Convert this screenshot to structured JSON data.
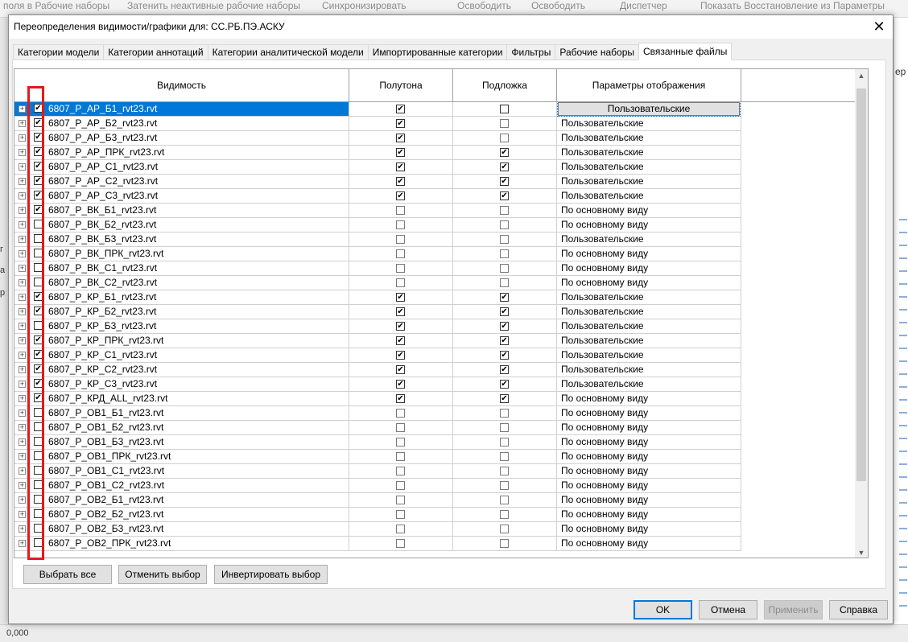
{
  "background": {
    "ribbon": [
      {
        "text": "поля в  Рабочие наборы"
      },
      {
        "text": "Затенить неактивные рабочие наборы"
      },
      {
        "text": "Синхронизировать"
      },
      {
        "text": "Освободить"
      },
      {
        "text": "Освободить"
      },
      {
        "text": "Диспетчер"
      },
      {
        "text": "Показать  Восстановление из   Параметры"
      }
    ],
    "right_label": "ер",
    "left_labels": [
      "г",
      "а",
      "р"
    ],
    "status_value": "0,000"
  },
  "dialog": {
    "title": "Переопределения видимости/графики для: СС.РБ.ПЭ.АСКУ",
    "close_label": "✕",
    "tabs": [
      {
        "label": "Категории модели",
        "active": false
      },
      {
        "label": "Категории аннотаций",
        "active": false
      },
      {
        "label": "Категории аналитической модели",
        "active": false
      },
      {
        "label": "Импортированные категории",
        "active": false
      },
      {
        "label": "Фильтры",
        "active": false
      },
      {
        "label": "Рабочие наборы",
        "active": false
      },
      {
        "label": "Связанные файлы",
        "active": true
      }
    ],
    "columns": [
      "Видимость",
      "Полутона",
      "Подложка",
      "Параметры отображения"
    ],
    "rows": [
      {
        "name": "6807_Р_АР_Б1_rvt23.rvt",
        "visible": true,
        "halftone": true,
        "underlay": false,
        "display": "Пользовательские",
        "selected": true
      },
      {
        "name": "6807_Р_АР_Б2_rvt23.rvt",
        "visible": true,
        "halftone": true,
        "underlay": false,
        "display": "Пользовательские"
      },
      {
        "name": "6807_Р_АР_Б3_rvt23.rvt",
        "visible": true,
        "halftone": true,
        "underlay": false,
        "display": "Пользовательские"
      },
      {
        "name": "6807_Р_АР_ПРК_rvt23.rvt",
        "visible": true,
        "halftone": true,
        "underlay": true,
        "display": "Пользовательские"
      },
      {
        "name": "6807_Р_АР_С1_rvt23.rvt",
        "visible": true,
        "halftone": true,
        "underlay": true,
        "display": "Пользовательские"
      },
      {
        "name": "6807_Р_АР_С2_rvt23.rvt",
        "visible": true,
        "halftone": true,
        "underlay": true,
        "display": "Пользовательские"
      },
      {
        "name": "6807_Р_АР_С3_rvt23.rvt",
        "visible": true,
        "halftone": true,
        "underlay": true,
        "display": "Пользовательские"
      },
      {
        "name": "6807_Р_ВК_Б1_rvt23.rvt",
        "visible": true,
        "halftone": false,
        "underlay": false,
        "display": "По основному виду"
      },
      {
        "name": "6807_Р_ВК_Б2_rvt23.rvt",
        "visible": false,
        "halftone": false,
        "underlay": false,
        "display": "По основному виду"
      },
      {
        "name": "6807_Р_ВК_Б3_rvt23.rvt",
        "visible": false,
        "halftone": false,
        "underlay": false,
        "display": "Пользовательские"
      },
      {
        "name": "6807_Р_ВК_ПРК_rvt23.rvt",
        "visible": false,
        "halftone": false,
        "underlay": false,
        "display": "По основному виду"
      },
      {
        "name": "6807_Р_ВК_С1_rvt23.rvt",
        "visible": false,
        "halftone": false,
        "underlay": false,
        "display": "По основному виду"
      },
      {
        "name": "6807_Р_ВК_С2_rvt23.rvt",
        "visible": false,
        "halftone": false,
        "underlay": false,
        "display": "По основному виду"
      },
      {
        "name": "6807_Р_КР_Б1_rvt23.rvt",
        "visible": true,
        "halftone": true,
        "underlay": true,
        "display": "Пользовательские"
      },
      {
        "name": "6807_Р_КР_Б2_rvt23.rvt",
        "visible": true,
        "halftone": true,
        "underlay": true,
        "display": "Пользовательские"
      },
      {
        "name": "6807_Р_КР_Б3_rvt23.rvt",
        "visible": false,
        "halftone": true,
        "underlay": true,
        "display": "Пользовательские"
      },
      {
        "name": "6807_Р_КР_ПРК_rvt23.rvt",
        "visible": true,
        "halftone": true,
        "underlay": true,
        "display": "Пользовательские"
      },
      {
        "name": "6807_Р_КР_С1_rvt23.rvt",
        "visible": true,
        "halftone": true,
        "underlay": true,
        "display": "Пользовательские"
      },
      {
        "name": "6807_Р_КР_С2_rvt23.rvt",
        "visible": true,
        "halftone": true,
        "underlay": true,
        "display": "Пользовательские"
      },
      {
        "name": "6807_Р_КР_С3_rvt23.rvt",
        "visible": true,
        "halftone": true,
        "underlay": true,
        "display": "Пользовательские"
      },
      {
        "name": "6807_Р_КРД_ALL_rvt23.rvt",
        "visible": true,
        "halftone": true,
        "underlay": true,
        "display": "По основному виду"
      },
      {
        "name": "6807_Р_ОВ1_Б1_rvt23.rvt",
        "visible": false,
        "halftone": false,
        "underlay": false,
        "display": "По основному виду"
      },
      {
        "name": "6807_Р_ОВ1_Б2_rvt23.rvt",
        "visible": false,
        "halftone": false,
        "underlay": false,
        "display": "По основному виду"
      },
      {
        "name": "6807_Р_ОВ1_Б3_rvt23.rvt",
        "visible": false,
        "halftone": false,
        "underlay": false,
        "display": "По основному виду"
      },
      {
        "name": "6807_Р_ОВ1_ПРК_rvt23.rvt",
        "visible": false,
        "halftone": false,
        "underlay": false,
        "display": "По основному виду"
      },
      {
        "name": "6807_Р_ОВ1_С1_rvt23.rvt",
        "visible": false,
        "halftone": false,
        "underlay": false,
        "display": "По основному виду"
      },
      {
        "name": "6807_Р_ОВ1_С2_rvt23.rvt",
        "visible": false,
        "halftone": false,
        "underlay": false,
        "display": "По основному виду"
      },
      {
        "name": "6807_Р_ОВ2_Б1_rvt23.rvt",
        "visible": false,
        "halftone": false,
        "underlay": false,
        "display": "По основному виду"
      },
      {
        "name": "6807_Р_ОВ2_Б2_rvt23.rvt",
        "visible": false,
        "halftone": false,
        "underlay": false,
        "display": "По основному виду"
      },
      {
        "name": "6807_Р_ОВ2_Б3_rvt23.rvt",
        "visible": false,
        "halftone": false,
        "underlay": false,
        "display": "По основному виду"
      },
      {
        "name": "6807_Р_ОВ2_ПРК_rvt23.rvt",
        "visible": false,
        "halftone": false,
        "underlay": false,
        "display": "По основному виду"
      }
    ],
    "buttons": {
      "select_all": "Выбрать все",
      "deselect": "Отменить выбор",
      "invert": "Инвертировать выбор",
      "ok": "OK",
      "cancel": "Отмена",
      "apply": "Применить",
      "help": "Справка"
    },
    "highlight_color": "#e21a1a",
    "selection_color": "#0078d7"
  }
}
